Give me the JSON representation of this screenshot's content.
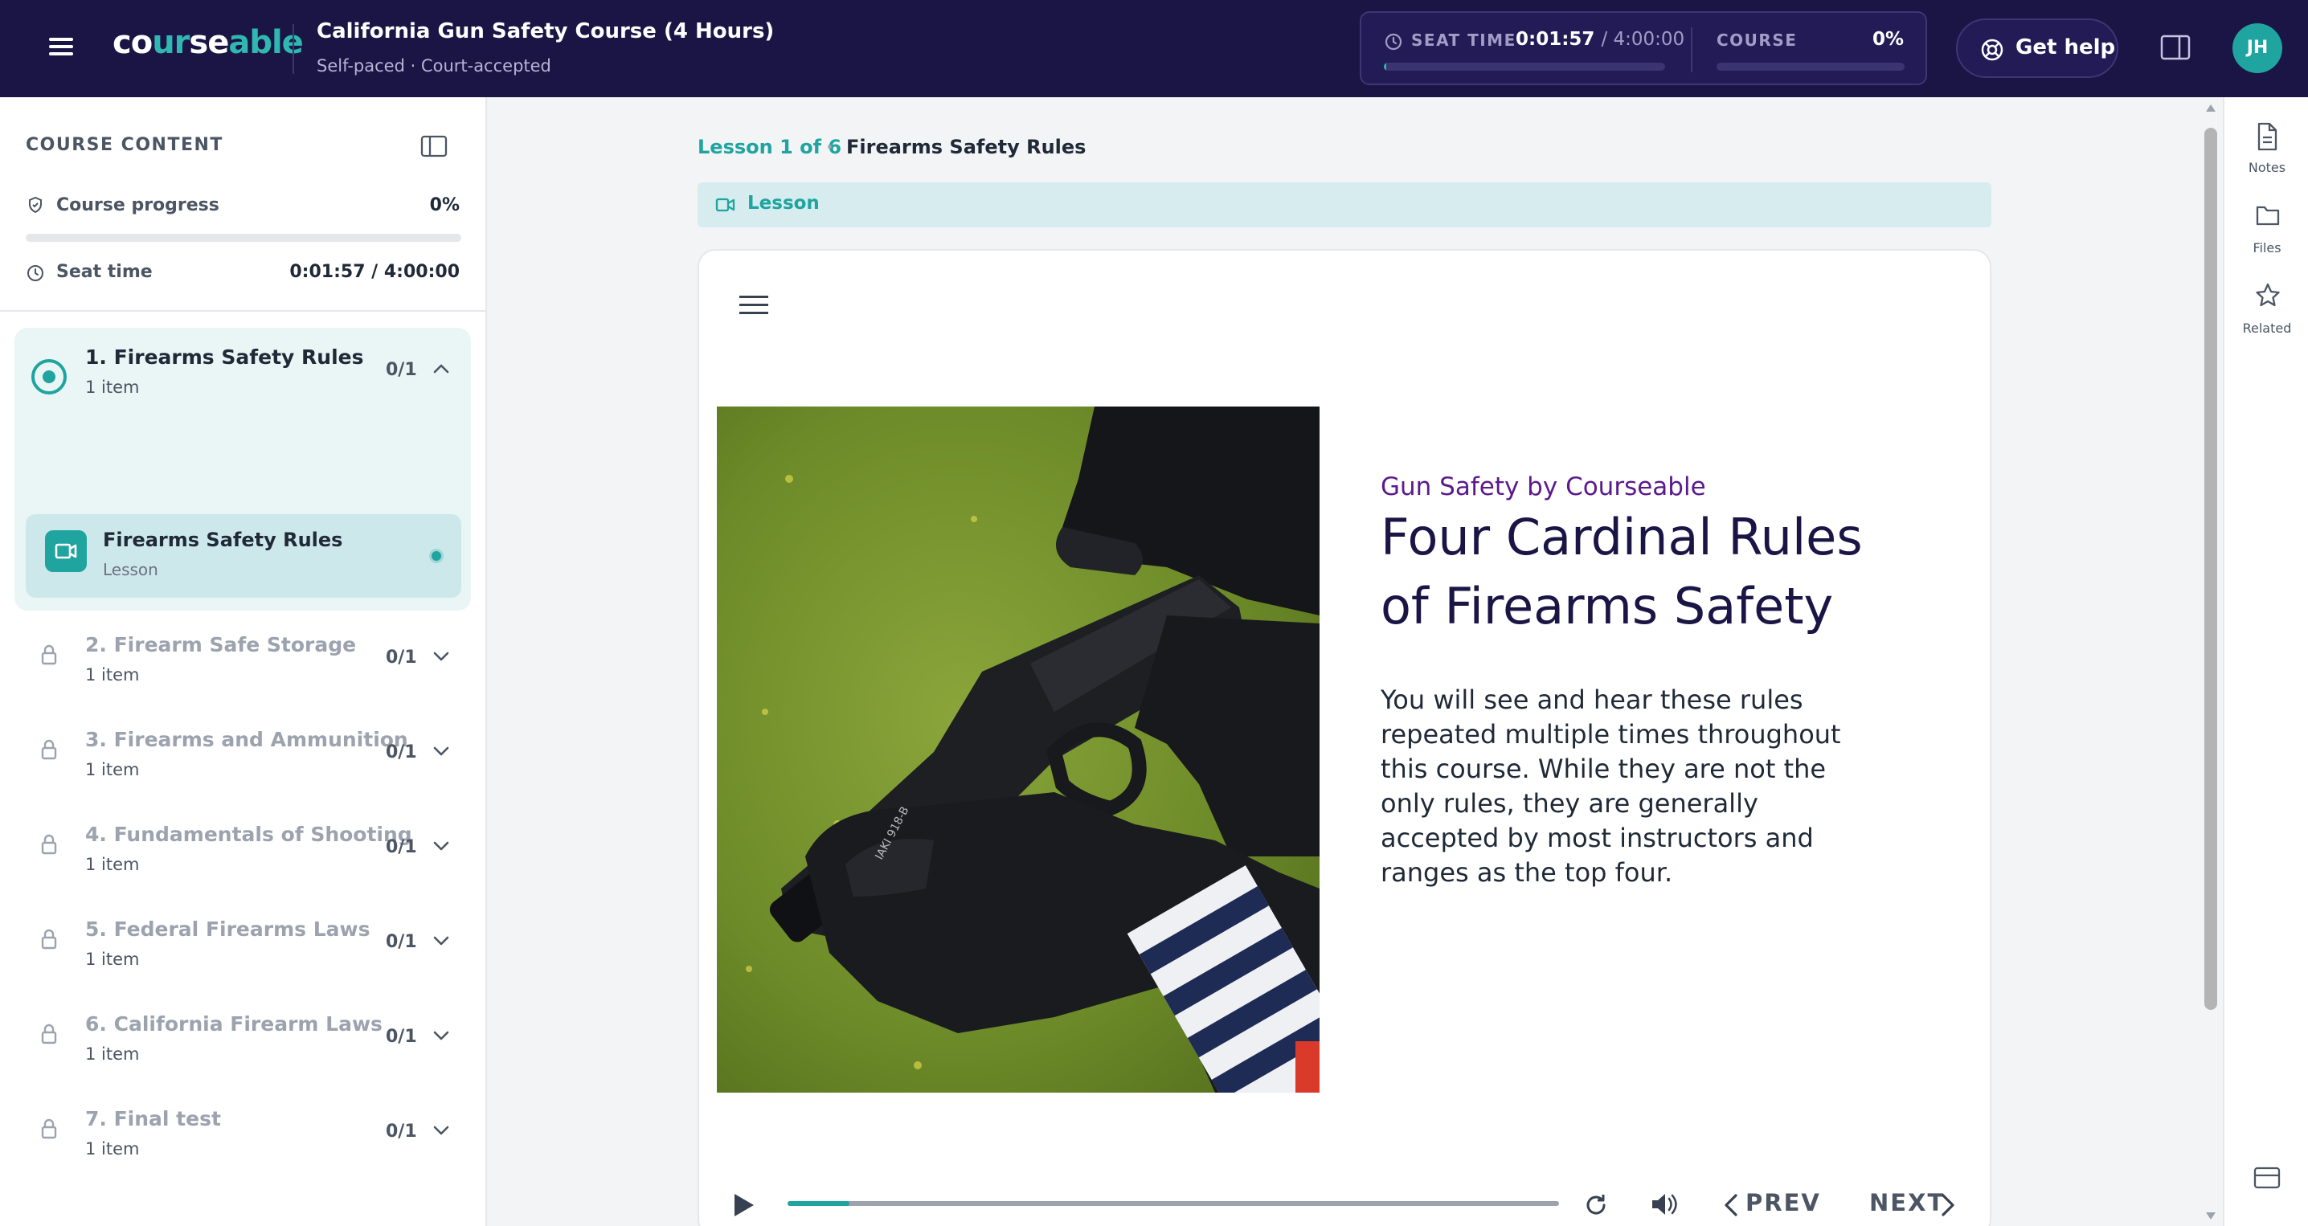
{
  "header": {
    "logo": {
      "part1": "co",
      "part2": "ur",
      "part3": "se",
      "part4": "able"
    },
    "title": "California Gun Safety Course (4 Hours)",
    "subtitle": "Self-paced · Court-accepted",
    "seat_time": {
      "label": "SEAT TIME",
      "value": "0:01:57",
      "total": "/ 4:00:00",
      "progress": 0.008
    },
    "course": {
      "label": "COURSE",
      "value": "0%",
      "progress": 0
    },
    "help_label": "Get help",
    "avatar_initials": "JH"
  },
  "sidebar": {
    "title": "COURSE CONTENT",
    "progress_label": "Course progress",
    "progress_value": "0%",
    "progress": 0,
    "seat_label": "Seat time",
    "seat_value": "0:01:57 / 4:00:00",
    "modules": [
      {
        "title": "1. Firearms Safety Rules",
        "sub": "1 item",
        "count": "0/1",
        "locked": false,
        "active": true
      },
      {
        "title": "2. Firearm Safe Storage",
        "sub": "1 item",
        "count": "0/1",
        "locked": true
      },
      {
        "title": "3. Firearms and Ammunition",
        "sub": "1 item",
        "count": "0/1",
        "locked": true
      },
      {
        "title": "4. Fundamentals of Shooting",
        "sub": "1 item",
        "count": "0/1",
        "locked": true
      },
      {
        "title": "5. Federal Firearms Laws",
        "sub": "1 item",
        "count": "0/1",
        "locked": true
      },
      {
        "title": "6. California Firearm Laws",
        "sub": "1 item",
        "count": "0/1",
        "locked": true
      },
      {
        "title": "7. Final test",
        "sub": "1 item",
        "count": "0/1",
        "locked": true
      }
    ],
    "active_lesson": {
      "title": "Firearms Safety Rules",
      "sub": "Lesson"
    }
  },
  "main": {
    "breadcrumb_lesson": "Lesson 1 of 6",
    "breadcrumb_sep": "·",
    "breadcrumb_title": "Firearms Safety Rules",
    "type_label": "Lesson",
    "slide": {
      "brand": "Gun Safety by Courseable",
      "heading": "Four Cardinal Rules of Firearms Safety",
      "body": "You will see and hear these rules repeated multiple times throughout this course. While they are not the only rules, they are generally accepted by most instructors and ranges as the top four.",
      "photo_text": "IAKI 918-B"
    },
    "player": {
      "progress": 0.08,
      "prev_label": "PREV",
      "next_label": "NEXT"
    }
  },
  "rail": {
    "items": [
      {
        "label": "Notes",
        "icon": "notes-icon"
      },
      {
        "label": "Files",
        "icon": "folder-icon"
      },
      {
        "label": "Related",
        "icon": "star-icon"
      }
    ]
  },
  "colors": {
    "brand_dark": "#1b1546",
    "accent_teal": "#1fa4a0",
    "brand_purple": "#5b1a8c"
  }
}
